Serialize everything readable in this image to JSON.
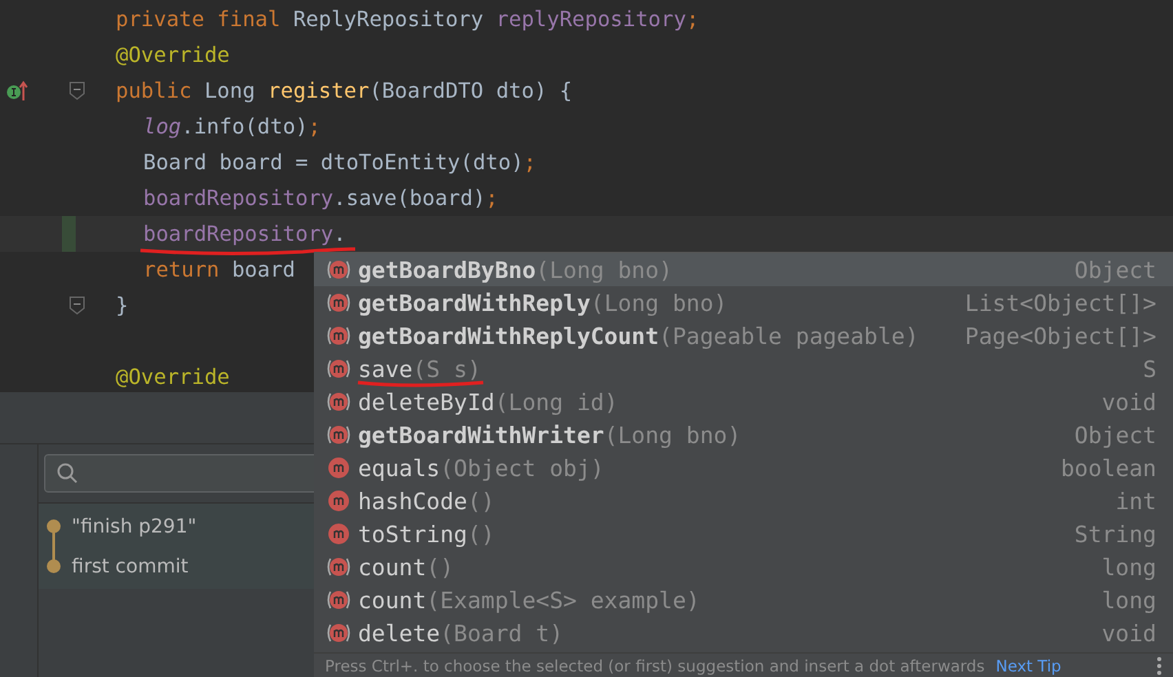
{
  "editor": {
    "lines": [
      {
        "tokens": [
          {
            "kind": "keyword",
            "text": "private final "
          },
          {
            "kind": "plain",
            "text": "ReplyRepository "
          },
          {
            "kind": "field",
            "text": "replyRepository"
          },
          {
            "kind": "keyword",
            "text": ";"
          }
        ]
      },
      {
        "tokens": [
          {
            "kind": "annotation",
            "text": "@Override"
          }
        ]
      },
      {
        "implements_marker": true,
        "fold": true,
        "tokens": [
          {
            "kind": "keyword",
            "text": "public "
          },
          {
            "kind": "plain",
            "text": "Long "
          },
          {
            "kind": "decl",
            "text": "register"
          },
          {
            "kind": "plain",
            "text": "(BoardDTO dto) {"
          }
        ],
        "children": [
          {
            "tokens": [
              {
                "kind": "static",
                "text": "log"
              },
              {
                "kind": "plain",
                "text": ".info(dto)"
              },
              {
                "kind": "keyword",
                "text": ";"
              }
            ]
          },
          {
            "tokens": [
              {
                "kind": "plain",
                "text": "Board board = dtoToEntity(dto)"
              },
              {
                "kind": "keyword",
                "text": ";"
              }
            ]
          },
          {
            "tokens": [
              {
                "kind": "field",
                "text": "boardRepository"
              },
              {
                "kind": "plain",
                "text": ".save(board)"
              },
              {
                "kind": "keyword",
                "text": ";"
              }
            ]
          },
          {
            "current": true,
            "changed": true,
            "underlined": true,
            "tokens": [
              {
                "kind": "field",
                "text": "boardRepository"
              },
              {
                "kind": "plain",
                "text": "."
              }
            ]
          },
          {
            "tokens": [
              {
                "kind": "keyword",
                "text": "return "
              },
              {
                "kind": "plain",
                "text": "board"
              }
            ]
          }
        ]
      },
      {
        "fold": true,
        "tokens": [
          {
            "kind": "plain",
            "text": "}"
          }
        ]
      },
      {
        "blank": true
      },
      {
        "tokens": [
          {
            "kind": "annotation",
            "text": "@Override"
          }
        ]
      }
    ]
  },
  "git_log": {
    "commits": [
      {
        "message": "\"finish p291\""
      },
      {
        "message": "first commit"
      }
    ]
  },
  "completion": {
    "items": [
      {
        "kind": "abstract",
        "name": "getBoardByBno",
        "params": "(Long bno)",
        "type": "Object",
        "bold": true,
        "selected": true,
        "underlined": false
      },
      {
        "kind": "abstract",
        "name": "getBoardWithReply",
        "params": "(Long bno)",
        "type": "List<Object[]>",
        "bold": true,
        "selected": false,
        "underlined": false
      },
      {
        "kind": "abstract",
        "name": "getBoardWithReplyCount",
        "params": "(Pageable pageable)",
        "type": "Page<Object[]>",
        "bold": true,
        "selected": false,
        "underlined": false
      },
      {
        "kind": "abstract",
        "name": "save",
        "params": "(S s)",
        "type": "S",
        "bold": false,
        "selected": false,
        "underlined": true
      },
      {
        "kind": "abstract",
        "name": "deleteById",
        "params": "(Long id)",
        "type": "void",
        "bold": false,
        "selected": false,
        "underlined": false
      },
      {
        "kind": "abstract",
        "name": "getBoardWithWriter",
        "params": "(Long bno)",
        "type": "Object",
        "bold": true,
        "selected": false,
        "underlined": false
      },
      {
        "kind": "method",
        "name": "equals",
        "params": "(Object obj)",
        "type": "boolean",
        "bold": false,
        "selected": false,
        "underlined": false
      },
      {
        "kind": "method",
        "name": "hashCode",
        "params": "()",
        "type": "int",
        "bold": false,
        "selected": false,
        "underlined": false
      },
      {
        "kind": "method",
        "name": "toString",
        "params": "()",
        "type": "String",
        "bold": false,
        "selected": false,
        "underlined": false
      },
      {
        "kind": "abstract",
        "name": "count",
        "params": "()",
        "type": "long",
        "bold": false,
        "selected": false,
        "underlined": false
      },
      {
        "kind": "abstract",
        "name": "count",
        "params": "(Example<S> example)",
        "type": "long",
        "bold": false,
        "selected": false,
        "underlined": false
      },
      {
        "kind": "abstract",
        "name": "delete",
        "params": "(Board t)",
        "type": "void",
        "bold": false,
        "selected": false,
        "underlined": false
      }
    ],
    "hint": "Press Ctrl+. to choose the selected (or first) suggestion and insert a dot afterwards",
    "next_tip": "Next Tip"
  }
}
